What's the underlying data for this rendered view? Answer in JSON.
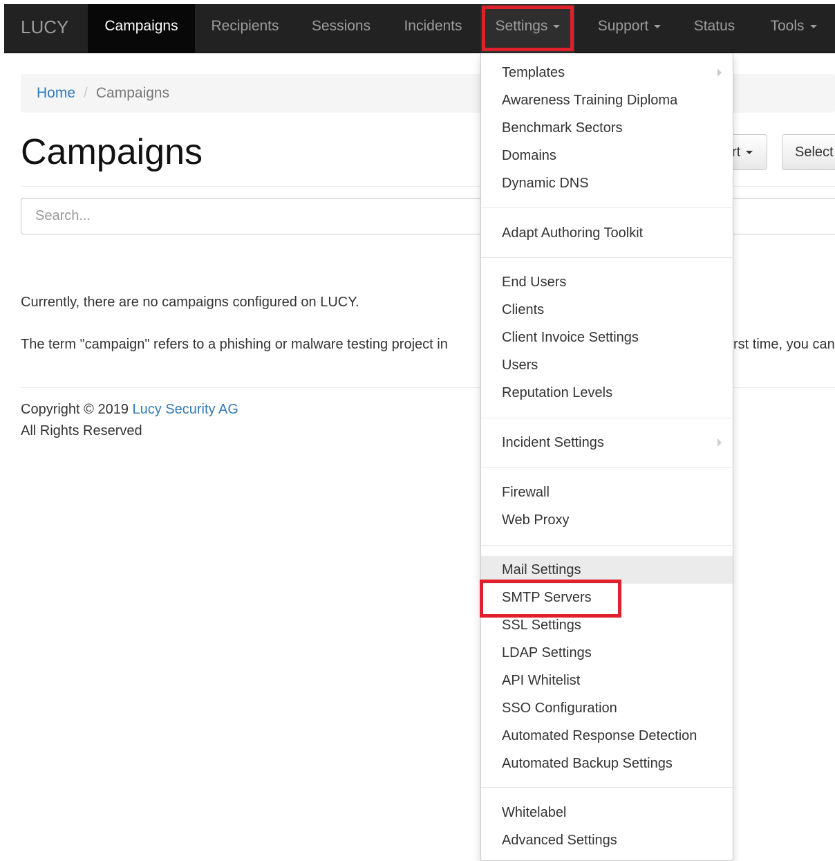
{
  "navbar": {
    "brand": "LUCY",
    "items": [
      {
        "label": "Campaigns"
      },
      {
        "label": "Recipients"
      },
      {
        "label": "Sessions"
      },
      {
        "label": "Incidents"
      },
      {
        "label": "Settings"
      },
      {
        "label": "Support"
      },
      {
        "label": "Status"
      },
      {
        "label": "Tools"
      }
    ]
  },
  "breadcrumb": {
    "home": "Home",
    "separator": "/",
    "current": "Campaigns"
  },
  "page": {
    "title": "Campaigns",
    "buttons": {
      "import_partial": "rt",
      "select_partial": "Select"
    },
    "search_placeholder": "Search...",
    "empty_text": "Currently, there are no campaigns configured on LUCY.",
    "term_text_left": "The term \"campaign\" refers to a phishing or malware testing project in",
    "term_text_right": "rst time, you can"
  },
  "footer": {
    "copyright_prefix": "Copyright © 2019",
    "company": "Lucy Security AG",
    "rights": "All Rights Reserved"
  },
  "settings_menu": {
    "group1": [
      "Templates",
      "Awareness Training Diploma",
      "Benchmark Sectors",
      "Domains",
      "Dynamic DNS"
    ],
    "group2": [
      "Adapt Authoring Toolkit"
    ],
    "group3": [
      "End Users",
      "Clients",
      "Client Invoice Settings",
      "Users",
      "Reputation Levels"
    ],
    "group4": [
      "Incident Settings"
    ],
    "group5": [
      "Firewall",
      "Web Proxy"
    ],
    "group6": [
      "Mail Settings",
      "SMTP Servers",
      "SSL Settings",
      "LDAP Settings",
      "API Whitelist",
      "SSO Configuration",
      "Automated Response Detection",
      "Automated Backup Settings"
    ],
    "group7": [
      "Whitelabel",
      "Advanced Settings"
    ]
  },
  "colors": {
    "navbar_bg": "#222222",
    "link": "#337ab7",
    "highlight": "#e0202a"
  }
}
